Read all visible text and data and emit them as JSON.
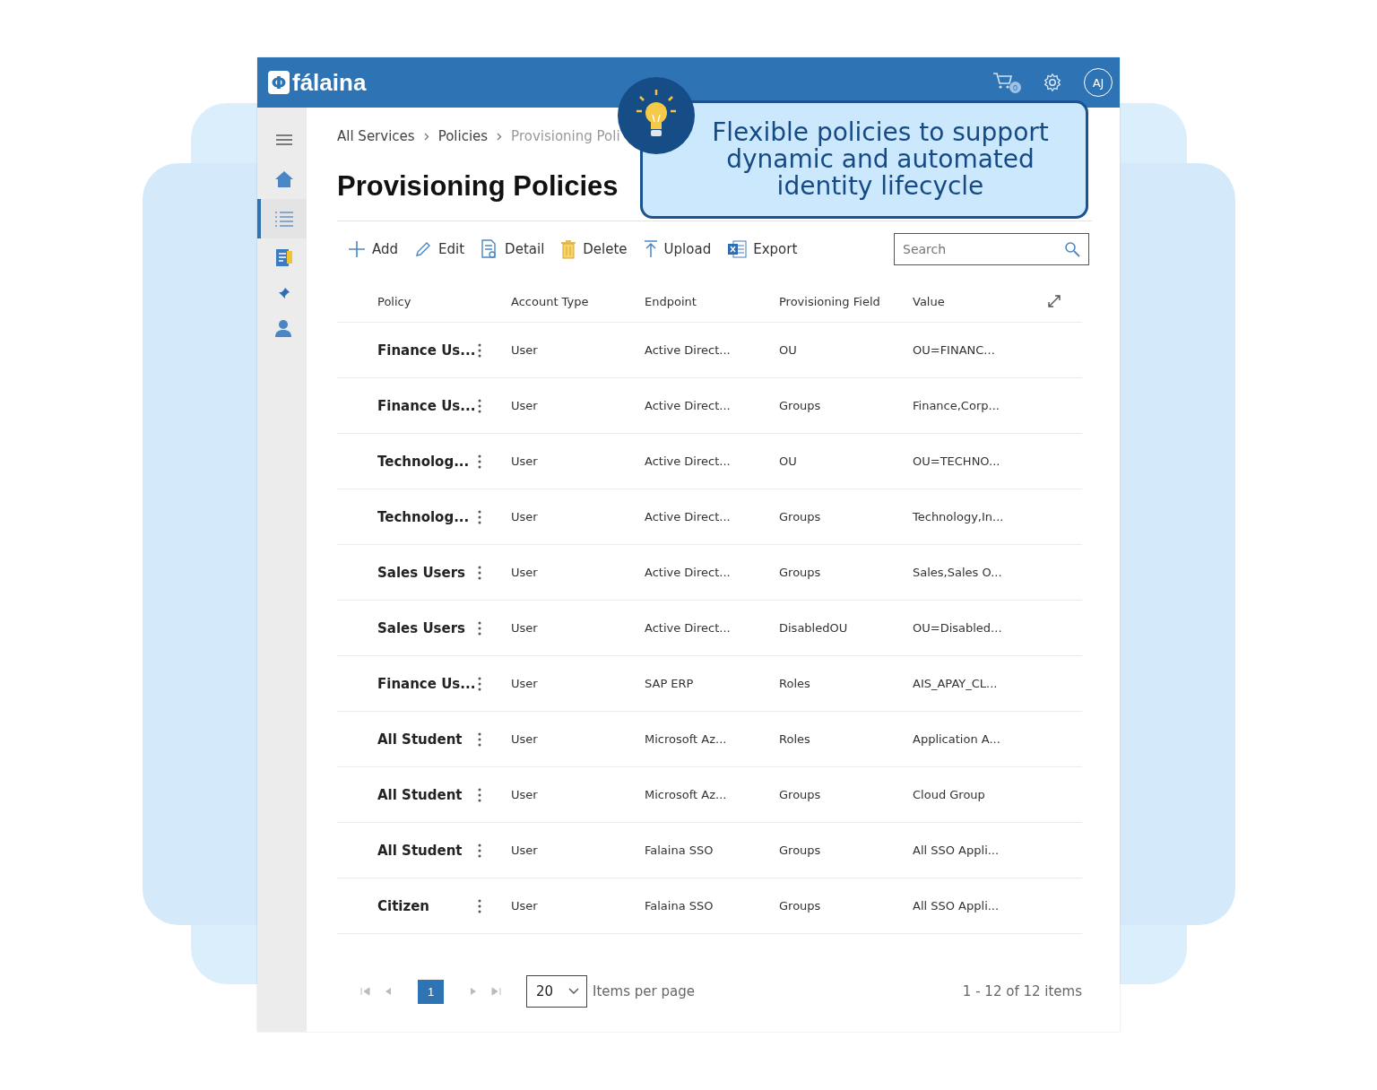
{
  "app": {
    "logo_mark": "Φ",
    "logo": "fálaina",
    "cart_count": "0",
    "avatar": "AJ"
  },
  "sidebar": {
    "items": [
      {
        "kind": "menu",
        "selected": false
      },
      {
        "kind": "home",
        "selected": false
      },
      {
        "kind": "list",
        "selected": true
      },
      {
        "kind": "report",
        "selected": false
      },
      {
        "kind": "pin",
        "selected": false
      },
      {
        "kind": "user",
        "selected": false
      }
    ]
  },
  "breadcrumb": [
    "All Services",
    "Policies",
    "Provisioning Poli"
  ],
  "title": "Provisioning Policies",
  "callout": {
    "lines": [
      "Flexible policies to support",
      "dynamic and automated",
      "identity lifecycle"
    ]
  },
  "toolbar": [
    {
      "kind": "add",
      "label": "Add"
    },
    {
      "kind": "edit",
      "label": "Edit"
    },
    {
      "kind": "detail",
      "label": "Detail"
    },
    {
      "kind": "delete",
      "label": "Delete"
    },
    {
      "kind": "upload",
      "label": "Upload"
    },
    {
      "kind": "export",
      "label": "Export"
    }
  ],
  "search": {
    "placeholder": "Search"
  },
  "table": {
    "columns": [
      "Policy",
      "Account Type",
      "Endpoint",
      "Provisioning Field",
      "Value"
    ],
    "rows": [
      [
        "Finance Us...",
        "User",
        "Active Direct...",
        "OU",
        "OU=FINANC..."
      ],
      [
        "Finance Us...",
        "User",
        "Active Direct...",
        "Groups",
        "Finance,Corp..."
      ],
      [
        "Technolog...",
        "User",
        "Active Direct...",
        "OU",
        "OU=TECHNO..."
      ],
      [
        "Technolog...",
        "User",
        "Active Direct...",
        "Groups",
        "Technology,In..."
      ],
      [
        "Sales Users",
        "User",
        "Active Direct...",
        "Groups",
        "Sales,Sales O..."
      ],
      [
        "Sales Users",
        "User",
        "Active Direct...",
        "DisabledOU",
        "OU=Disabled..."
      ],
      [
        "Finance Us...",
        "User",
        "SAP ERP",
        "Roles",
        "AIS_APAY_CL..."
      ],
      [
        "All Student",
        "User",
        "Microsoft Az...",
        "Roles",
        "Application A..."
      ],
      [
        "All Student",
        "User",
        "Microsoft Az...",
        "Groups",
        "Cloud Group"
      ],
      [
        "All Student",
        "User",
        "Falaina SSO",
        "Groups",
        "All SSO Appli..."
      ],
      [
        "Citizen",
        "User",
        "Falaina SSO",
        "Groups",
        "All SSO Appli..."
      ]
    ]
  },
  "pagination": {
    "pages": [
      {
        "label": "1",
        "selected": true
      }
    ],
    "page_size": "20",
    "page_size_label": "Items per page",
    "summary": "1 - 12 of 12 items"
  }
}
